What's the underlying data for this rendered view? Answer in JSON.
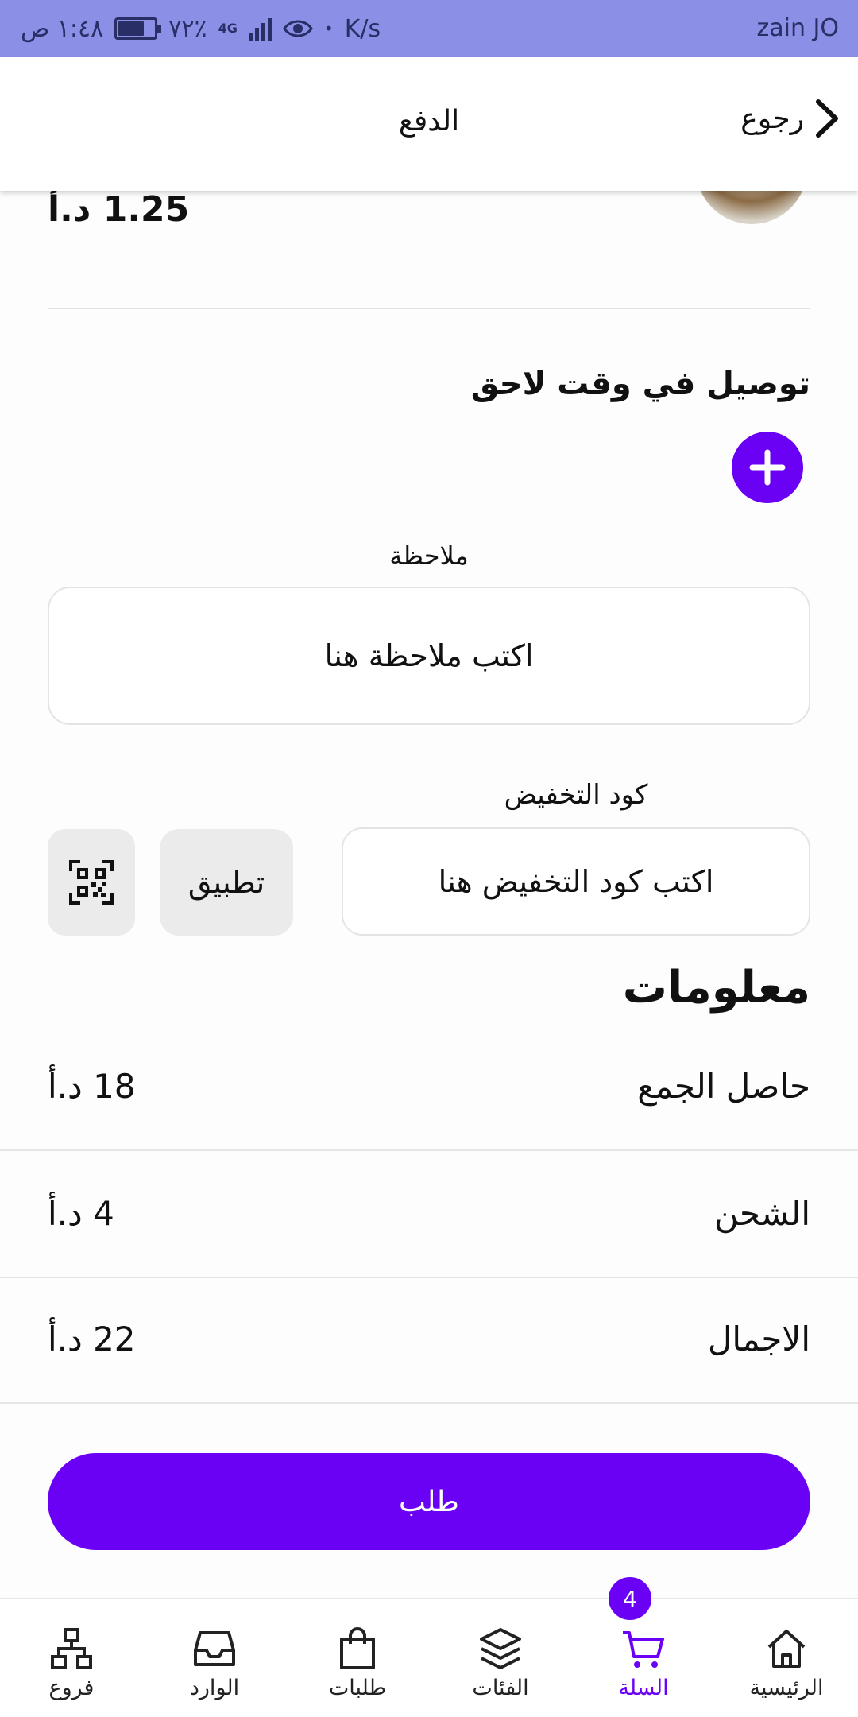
{
  "status_bar": {
    "carrier": "zain JO",
    "time": "١:٤٨ ص",
    "battery": "٧٢٪",
    "network": "4G",
    "speed": "K/s"
  },
  "header": {
    "title": "الدفع",
    "back_label": "رجوع"
  },
  "cart_item": {
    "price": "1.25 د.أ"
  },
  "delivery": {
    "title": "توصيل في وقت لاحق"
  },
  "note": {
    "label": "ملاحظة",
    "placeholder": "اكتب ملاحظة هنا"
  },
  "coupon": {
    "label": "كود التخفيض",
    "placeholder": "اكتب كود التخفيض هنا",
    "apply_label": "تطبيق"
  },
  "info": {
    "title": "معلومات",
    "rows": [
      {
        "label": "حاصل الجمع",
        "value": "18 د.أ"
      },
      {
        "label": "الشحن",
        "value": "4 د.أ"
      },
      {
        "label": "الاجمال",
        "value": "22 د.أ"
      }
    ]
  },
  "order_button": "طلب",
  "bottom_nav": {
    "items": [
      {
        "label": "الرئيسية",
        "icon": "home-icon"
      },
      {
        "label": "السلة",
        "icon": "cart-icon",
        "active": true,
        "badge": "4"
      },
      {
        "label": "الفئات",
        "icon": "layers-icon"
      },
      {
        "label": "طلبات",
        "icon": "bag-icon"
      },
      {
        "label": "الوارد",
        "icon": "inbox-icon"
      },
      {
        "label": "فروع",
        "icon": "branches-icon"
      }
    ]
  },
  "colors": {
    "accent": "#6a00f4",
    "status_bar": "#8b90e6"
  }
}
